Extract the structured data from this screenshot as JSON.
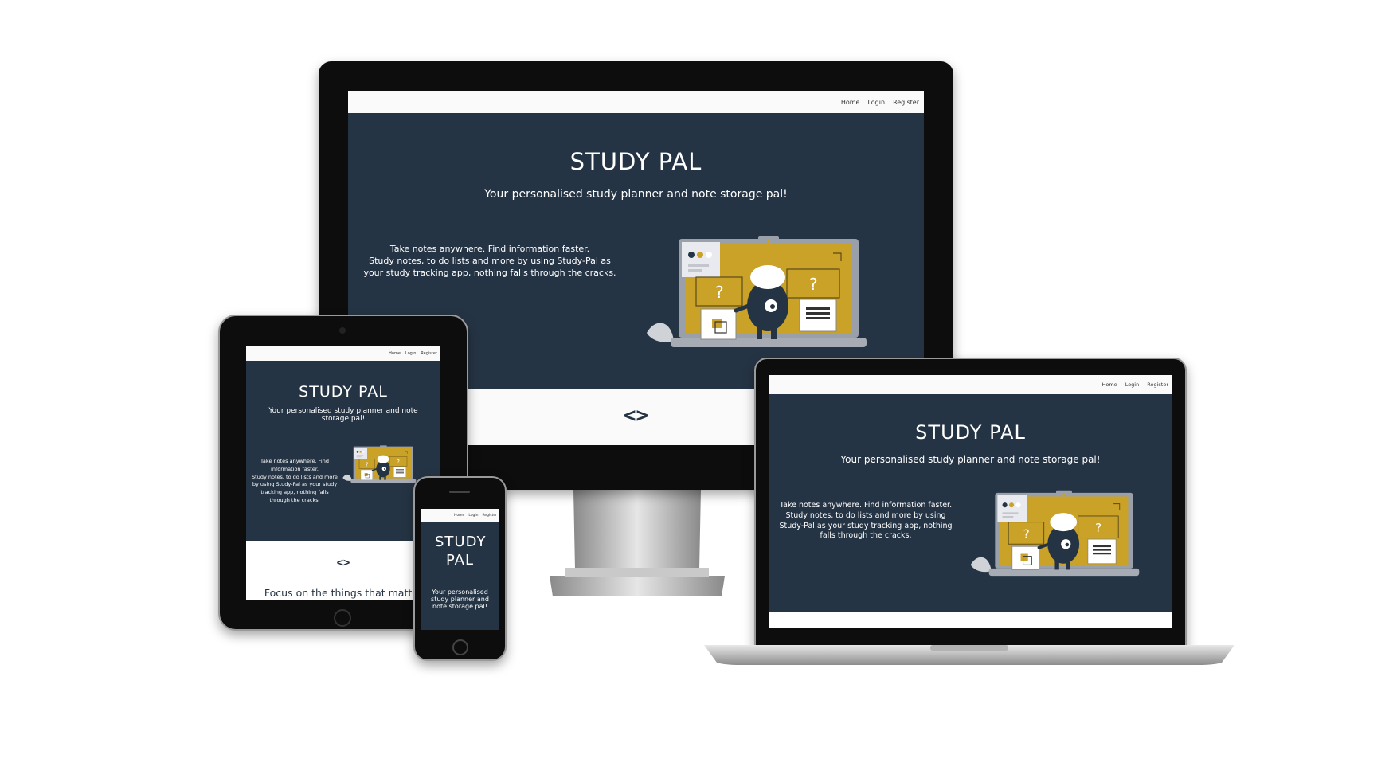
{
  "site": {
    "nav_links": [
      "Home",
      "Login",
      "Register"
    ],
    "title": "STUDY PAL",
    "tagline": "Your personalised study planner and note storage pal!",
    "desc_line1": "Take notes anywhere. Find information faster.",
    "desc_line2": "Study notes, to do lists and more by using Study-Pal as your study tracking app, nothing falls through the cracks.",
    "section_heading": "Focus on the things that matter"
  },
  "icons": {
    "code": "code-icon",
    "illustration": "laptop-illustration"
  },
  "colors": {
    "hero_bg": "#253444",
    "accent": "#C9A227",
    "nav_bg": "#FAFAFA",
    "page_bg": "#FFFFFF",
    "bezel": "#0D0D0D"
  }
}
